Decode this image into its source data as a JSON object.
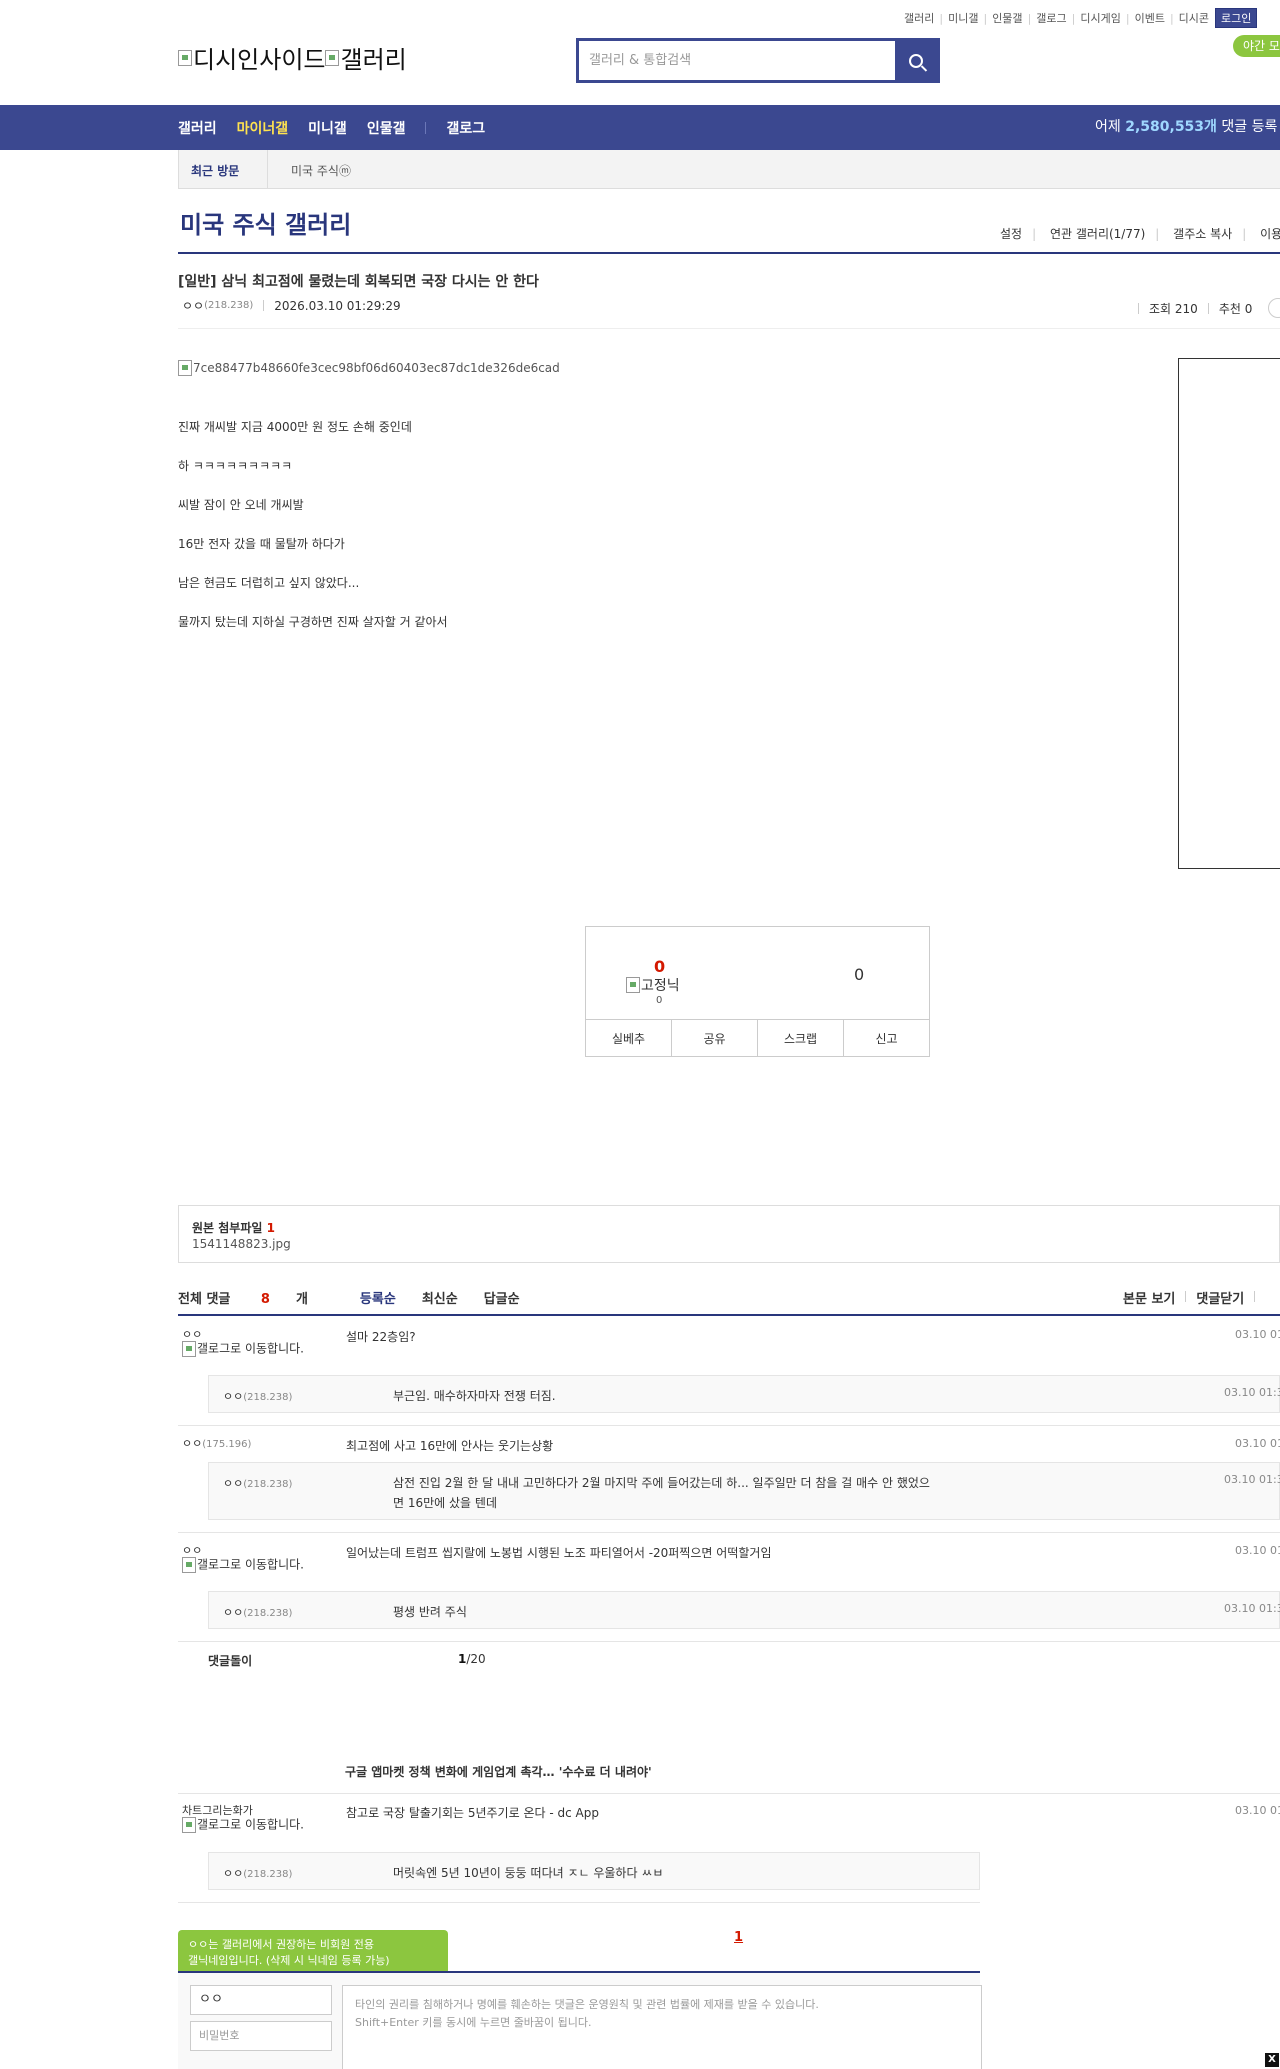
{
  "util": {
    "items": [
      "갤러리",
      "미니갤",
      "인물갤",
      "갤로그",
      "디시게임",
      "이벤트",
      "디시콘"
    ],
    "login": "로그인",
    "night_mode": "야간 모"
  },
  "logo": {
    "site_alt": "디시인사이드",
    "gallery_alt": "갤러리"
  },
  "search": {
    "placeholder": "갤러리 & 통합검색"
  },
  "gnb": {
    "items": [
      "갤러리",
      "마이너갤",
      "미니갤",
      "인물갤",
      "갤로그"
    ],
    "count_prefix": "어제 ",
    "count_value": "2,580,553개",
    "count_suffix": " 댓글 등록"
  },
  "recent": {
    "label": "최근 방문",
    "item": "미국 주식ⓜ"
  },
  "gallery": {
    "title": "미국 주식 갤러리",
    "tools": [
      "설정",
      "연관 갤러리(1/77)",
      "갤주소 복사",
      "이용"
    ]
  },
  "post": {
    "title": "[일반] 삼닉 최고점에 물렸는데 회복되면 국장 다시는 안 한다",
    "author": "ㅇㅇ",
    "author_ip": "(218.238)",
    "datetime": "2026.03.10 01:29:29",
    "views": "조회 210",
    "recommend": "추천 0",
    "image_alt": "7ce88477b48660fe3cec98bf06d60403ec87dc1de326de6cad",
    "body": [
      "진짜 개씨발 지금 4000만 원 정도 손해 중인데",
      "하 ㅋㅋㅋㅋㅋㅋㅋㅋㅋ",
      "씨발 잠이 안 오네 개씨발",
      "16만 전자 갔을 때 물탈까 하다가",
      "남은 현금도 더럽히고 싶지 않았다...",
      "물까지 탔는데 지하실 구경하면 진짜 살자할 거 같아서"
    ]
  },
  "recommend_box": {
    "up_count": "0",
    "fixed_alt": "고정닉",
    "up_fixed_count": "0",
    "down_count": "0",
    "buttons": [
      "실베추",
      "공유",
      "스크랩",
      "신고"
    ]
  },
  "attach": {
    "label": "원본 첨부파일",
    "count": "1",
    "file": "1541148823.jpg"
  },
  "comments_header": {
    "total_label": "전체 댓글",
    "total_count": "8",
    "total_unit": "개",
    "sort": [
      "등록순",
      "최신순",
      "답글순"
    ],
    "right": [
      "본문 보기",
      "댓글닫기"
    ]
  },
  "comments": [
    {
      "nick": "ㅇㅇ",
      "ip": "",
      "blink": "갤로그로 이동합니다.",
      "text": "설마 22층임?",
      "date": "03.10 01",
      "reply": {
        "nick": "ㅇㅇ",
        "ip": "(218.238)",
        "text": "부근임. 매수하자마자 전쟁 터짐.",
        "date": "03.10 01:3"
      }
    },
    {
      "nick": "ㅇㅇ",
      "ip": "(175.196)",
      "blink": "",
      "text": "최고점에 사고 16만에 안사는 웃기는상황",
      "date": "03.10 01",
      "reply": {
        "nick": "ㅇㅇ",
        "ip": "(218.238)",
        "text": "삼전 진입 2월 한 달 내내 고민하다가 2월 마지막 주에 들어갔는데 하... 일주일만 더 참을 걸 매수 안 했었으면 16만에 샀을 텐데",
        "date": "03.10 01:3"
      }
    },
    {
      "nick": "ㅇㅇ",
      "ip": "",
      "blink": "갤로그로 이동합니다.",
      "text": "일어났는데 트럼프 씹지랄에 노봉법 시행된 노조 파티열어서 -20퍼찍으면 어떡할거임",
      "date": "03.10 01",
      "reply": {
        "nick": "ㅇㅇ",
        "ip": "(218.238)",
        "text": "평생 반려 주식",
        "date": "03.10 01:3"
      }
    }
  ],
  "comments_footer": {
    "label": "댓글돌이",
    "page": "1",
    "page_total": "/20"
  },
  "news": {
    "title": "구글 앱마켓 정책 변화에 게임업계 촉각… '수수료 더 내려야'"
  },
  "comment4": {
    "nick": "차트그리는화가",
    "blink": "갤로그로 이동합니다.",
    "text": "참고로 국장 탈출기회는 5년주기로 온다 - dc App",
    "date": "03.10 01",
    "reply": {
      "nick": "ㅇㅇ",
      "ip": "(218.238)",
      "text": "머릿속엔 5년 10년이 둥둥 떠다녀 ㅈㄴ 우울하다 ㅆㅂ"
    }
  },
  "pager": {
    "current": "1"
  },
  "write": {
    "bubble_line1": "ㅇㅇ는 갤러리에서 권장하는 비회원 전용",
    "bubble_line2": "갤닉네임입니다. (삭제 시 닉네임 등록 가능)",
    "nick_value": "ㅇㅇ",
    "pw_placeholder": "비밀번호",
    "textarea_line1": "타인의 권리를 침해하거나 명예를 훼손하는 댓글은 운영원칙 및 관련 법률에 제재를 받을 수 있습니다.",
    "textarea_line2": "Shift+Enter 키를 동시에 누르면 줄바꿈이 됩니다."
  },
  "close_label": "X"
}
